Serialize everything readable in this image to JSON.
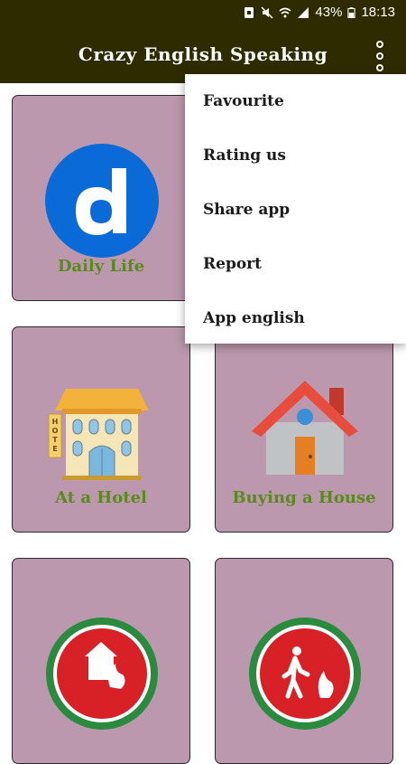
{
  "status_bar": {
    "battery": "43%",
    "time": "18:13",
    "icons": [
      "sim-icon",
      "mute-icon",
      "wifi-icon",
      "signal-icon",
      "battery-icon"
    ]
  },
  "toolbar": {
    "title": "Crazy English Speaking",
    "overflow_icon": "more-vert-icon"
  },
  "cards": [
    {
      "label": "Daily Life",
      "icon": "dailymotion-d-icon"
    },
    {
      "label": "",
      "icon": ""
    },
    {
      "label": "At a Hotel",
      "icon": "hotel-icon"
    },
    {
      "label": "Buying a House",
      "icon": "house-icon"
    },
    {
      "label": "",
      "icon": "fire-house-icon"
    },
    {
      "label": "",
      "icon": "fire-exit-icon"
    }
  ],
  "menu": {
    "items": [
      {
        "label": "Favourite"
      },
      {
        "label": "Rating us"
      },
      {
        "label": "Share app"
      },
      {
        "label": "Report"
      },
      {
        "label": "App english"
      }
    ]
  },
  "colors": {
    "toolbar_bg": "#2f2b00",
    "card_bg": "#bb98ad",
    "label_green": "#5a8a1e"
  }
}
